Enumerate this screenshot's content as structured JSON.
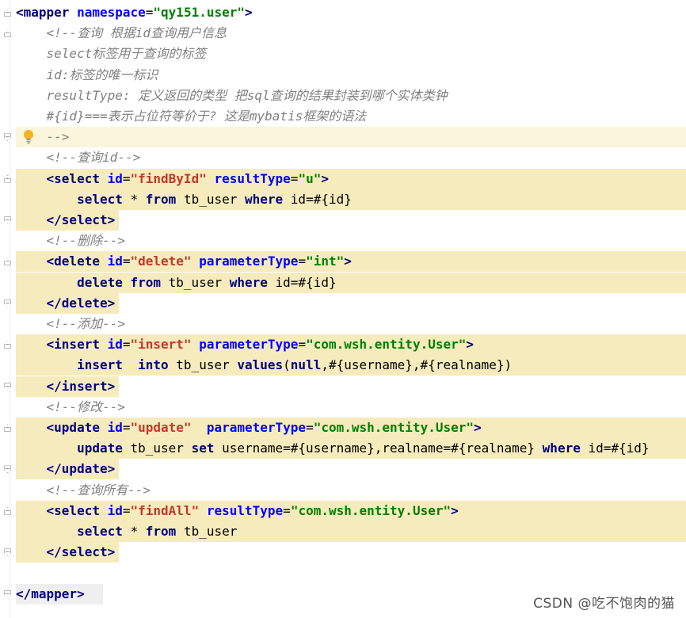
{
  "editor": {
    "lines": [
      {
        "segments": [
          [
            "t",
            "<mapper "
          ],
          [
            "a",
            "namespace"
          ],
          [
            "p",
            "="
          ],
          [
            "s",
            "\"qy151.user\""
          ],
          [
            "t",
            ">"
          ]
        ]
      },
      {
        "segments": [
          [
            "c",
            "    <!--查询 根据id查询用户信息"
          ]
        ]
      },
      {
        "segments": [
          [
            "c",
            "    select标签用于查询的标签"
          ]
        ]
      },
      {
        "segments": [
          [
            "c",
            "    id:标签的唯一标识"
          ]
        ]
      },
      {
        "segments": [
          [
            "c",
            "    resultType: 定义返回的类型 把sql查询的结果封装到哪个实体类钟"
          ]
        ]
      },
      {
        "segments": [
          [
            "c",
            "    #{id}===表示占位符等价于? 这是mybatis框架的语法"
          ]
        ]
      },
      {
        "segments": [
          [
            "c",
            "    -->"
          ]
        ]
      },
      {
        "segments": [
          [
            "c",
            "    <!--查询id-->"
          ]
        ]
      },
      {
        "segments": [
          [
            "p",
            "    "
          ],
          [
            "t",
            "<select "
          ],
          [
            "a",
            "id"
          ],
          [
            "p",
            "="
          ],
          [
            "sr",
            "\"findById\""
          ],
          [
            "p",
            " "
          ],
          [
            "a",
            "resultType"
          ],
          [
            "p",
            "="
          ],
          [
            "s",
            "\"u\""
          ],
          [
            "t",
            ">"
          ]
        ]
      },
      {
        "segments": [
          [
            "p",
            "        "
          ],
          [
            "k",
            "select "
          ],
          [
            "p",
            "* "
          ],
          [
            "k",
            "from "
          ],
          [
            "p",
            "tb_user "
          ],
          [
            "k",
            "where "
          ],
          [
            "p",
            "id=#{id}"
          ]
        ]
      },
      {
        "segments": [
          [
            "p",
            "    "
          ],
          [
            "t",
            "</select>"
          ]
        ]
      },
      {
        "segments": [
          [
            "c",
            "    <!--删除-->"
          ]
        ]
      },
      {
        "segments": [
          [
            "p",
            "    "
          ],
          [
            "t",
            "<delete "
          ],
          [
            "a",
            "id"
          ],
          [
            "p",
            "="
          ],
          [
            "sr",
            "\"delete\""
          ],
          [
            "p",
            " "
          ],
          [
            "a",
            "parameterType"
          ],
          [
            "p",
            "="
          ],
          [
            "s",
            "\"int\""
          ],
          [
            "t",
            ">"
          ]
        ]
      },
      {
        "segments": [
          [
            "p",
            "        "
          ],
          [
            "k",
            "delete from "
          ],
          [
            "p",
            "tb_user "
          ],
          [
            "k",
            "where "
          ],
          [
            "p",
            "id=#{id}"
          ]
        ]
      },
      {
        "segments": [
          [
            "p",
            "    "
          ],
          [
            "t",
            "</delete>"
          ]
        ]
      },
      {
        "segments": [
          [
            "c",
            "    <!--添加-->"
          ]
        ]
      },
      {
        "segments": [
          [
            "p",
            "    "
          ],
          [
            "t",
            "<insert "
          ],
          [
            "a",
            "id"
          ],
          [
            "p",
            "="
          ],
          [
            "sr",
            "\"insert\""
          ],
          [
            "p",
            " "
          ],
          [
            "a",
            "parameterType"
          ],
          [
            "p",
            "="
          ],
          [
            "s",
            "\"com.wsh.entity.User\""
          ],
          [
            "t",
            ">"
          ]
        ]
      },
      {
        "segments": [
          [
            "p",
            "        "
          ],
          [
            "k",
            "insert  into "
          ],
          [
            "p",
            "tb_user "
          ],
          [
            "k",
            "values"
          ],
          [
            "p",
            "("
          ],
          [
            "k",
            "null"
          ],
          [
            "p",
            ",#{username},#{realname})"
          ]
        ]
      },
      {
        "segments": [
          [
            "p",
            "    "
          ],
          [
            "t",
            "</insert>"
          ]
        ]
      },
      {
        "segments": [
          [
            "c",
            "    <!--修改-->"
          ]
        ]
      },
      {
        "segments": [
          [
            "p",
            "    "
          ],
          [
            "t",
            "<update "
          ],
          [
            "a",
            "id"
          ],
          [
            "p",
            "="
          ],
          [
            "sr",
            "\"update\""
          ],
          [
            "p",
            "  "
          ],
          [
            "a",
            "parameterType"
          ],
          [
            "p",
            "="
          ],
          [
            "s",
            "\"com.wsh.entity.User\""
          ],
          [
            "t",
            ">"
          ]
        ]
      },
      {
        "segments": [
          [
            "p",
            "        "
          ],
          [
            "k",
            "update "
          ],
          [
            "p",
            "tb_user "
          ],
          [
            "k",
            "set "
          ],
          [
            "p",
            "username=#{username},realname=#{realname} "
          ],
          [
            "k",
            "where "
          ],
          [
            "p",
            "id=#{id}"
          ]
        ]
      },
      {
        "segments": [
          [
            "p",
            "    "
          ],
          [
            "t",
            "</update>"
          ]
        ]
      },
      {
        "segments": [
          [
            "c",
            "    <!--查询所有-->"
          ]
        ]
      },
      {
        "segments": [
          [
            "p",
            "    "
          ],
          [
            "t",
            "<select "
          ],
          [
            "a",
            "id"
          ],
          [
            "p",
            "="
          ],
          [
            "sr",
            "\"findAll\""
          ],
          [
            "p",
            " "
          ],
          [
            "a",
            "resultType"
          ],
          [
            "p",
            "="
          ],
          [
            "s",
            "\"com.wsh.entity.User\""
          ],
          [
            "t",
            ">"
          ]
        ]
      },
      {
        "segments": [
          [
            "p",
            "        "
          ],
          [
            "k",
            "select "
          ],
          [
            "p",
            "* "
          ],
          [
            "k",
            "from "
          ],
          [
            "p",
            "tb_user"
          ]
        ]
      },
      {
        "segments": [
          [
            "p",
            "    "
          ],
          [
            "t",
            "</select>"
          ]
        ]
      },
      {
        "segments": [
          [
            "p",
            ""
          ]
        ]
      },
      {
        "segments": [
          [
            "t",
            "</mapper>"
          ]
        ]
      }
    ]
  },
  "watermark": "CSDN @吃不饱肉的猫",
  "icons": {
    "intention": "lightbulb-icon",
    "fold": "fold-marker-icon"
  }
}
